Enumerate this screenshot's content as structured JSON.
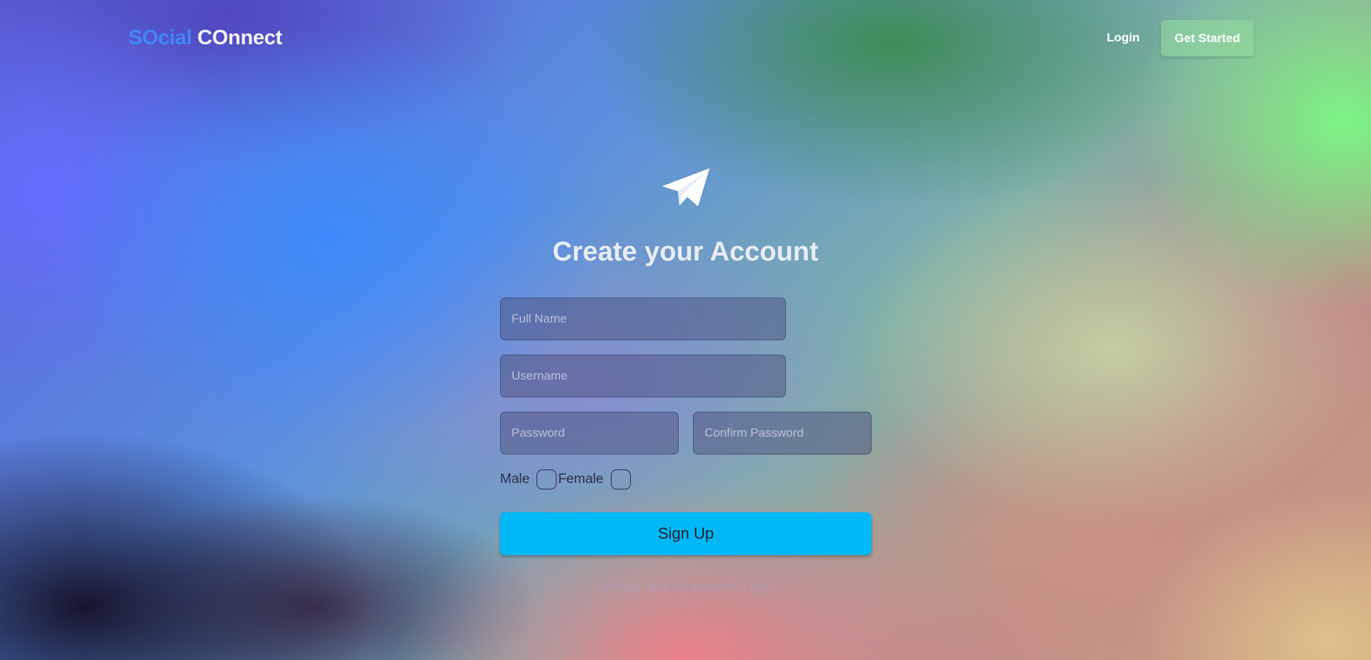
{
  "header": {
    "logo_part1": "SOcial",
    "logo_part2": "COnnect",
    "login_label": "Login",
    "cta_label": "Get Started"
  },
  "hero": {
    "icon": "paper-plane-icon",
    "title": "Create your Account"
  },
  "form": {
    "fullname_placeholder": "Full Name",
    "username_placeholder": "Username",
    "password_placeholder": "Password",
    "confirm_placeholder": "Confirm Password",
    "gender_male": "Male",
    "gender_female": "Female",
    "submit_label": "Sign Up",
    "already_text": "Already have an account?",
    "login_link": "Login"
  },
  "colors": {
    "accent_blue": "#3f86f5",
    "button_cyan": "#00b8f5"
  }
}
